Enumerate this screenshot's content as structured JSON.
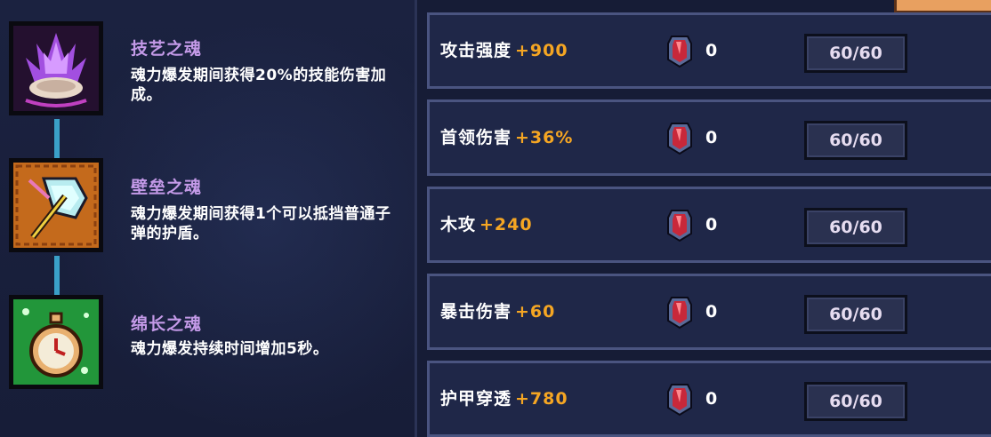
{
  "souls": [
    {
      "name": "技艺之魂",
      "desc": "魂力爆发期间获得20%的技能伤害加成。",
      "icon": "purple-crystal-icon"
    },
    {
      "name": "壁垒之魂",
      "desc": "魂力爆发期间获得1个可以抵挡普通子弹的护盾。",
      "icon": "shield-axe-icon"
    },
    {
      "name": "绵长之魂",
      "desc": "魂力爆发持续时间增加5秒。",
      "icon": "stopwatch-icon"
    }
  ],
  "stats": [
    {
      "label": "攻击强度",
      "bonus": "+900",
      "gems": "0",
      "level": "60/60"
    },
    {
      "label": "首领伤害",
      "bonus": "+36%",
      "gems": "0",
      "level": "60/60"
    },
    {
      "label": "木攻",
      "bonus": "+240",
      "gems": "0",
      "level": "60/60"
    },
    {
      "label": "暴击伤害",
      "bonus": "+60",
      "gems": "0",
      "level": "60/60"
    },
    {
      "label": "护甲穿透",
      "bonus": "+780",
      "gems": "0",
      "level": "60/60"
    }
  ],
  "colors": {
    "soul_title": "#c49ae8",
    "bonus": "#f5a623",
    "connector": "#3aa0c8"
  }
}
